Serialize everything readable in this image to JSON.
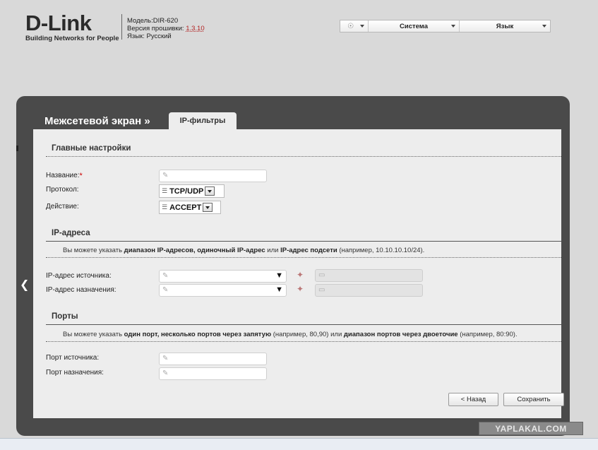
{
  "header": {
    "logo_brand": "D-Link",
    "logo_tagline": "Building Networks for People",
    "model": "Модель:DIR-620",
    "firmware_label": "Версия прошивки:",
    "firmware_value": "1.3.10",
    "language_info": "Язык: Русский"
  },
  "topbar": {
    "hint_icon": "lightbulb-icon",
    "system_label": "Система",
    "language_label": "Язык"
  },
  "panel": {
    "title": "Межсетевой экран »",
    "tab_label": "IP-фильтры"
  },
  "sections": {
    "main": {
      "title": "Главные настройки",
      "name_label": "Название:",
      "required_mark": "*",
      "protocol_label": "Протокол:",
      "protocol_value": "TCP/UDP",
      "action_label": "Действие:",
      "action_value": "ACCEPT"
    },
    "ip": {
      "title": "IP-адреса",
      "hint_pre": "Вы можете указать ",
      "hint_b1": "диапазон IP-адресов, одиночный IP-адрес",
      "hint_mid": " или ",
      "hint_b2": "IP-адрес подсети",
      "hint_post": " (например, 10.10.10.10/24).",
      "source_label": "IP-адрес источника:",
      "dest_label": "IP-адрес назначения:"
    },
    "ports": {
      "title": "Порты",
      "hint_pre": "Вы можете указать ",
      "hint_b1": "один порт, несколько портов через запятую",
      "hint_mid": " (например, 80,90) или ",
      "hint_b2": "диапазон портов через двоеточие",
      "hint_post": " (например, 80:90).",
      "source_label": "Порт источника:",
      "dest_label": "Порт назначения:"
    }
  },
  "buttons": {
    "back_label": "< Назад",
    "save_label": "Сохранить"
  },
  "watermark": "YAPLAKAL.COM"
}
